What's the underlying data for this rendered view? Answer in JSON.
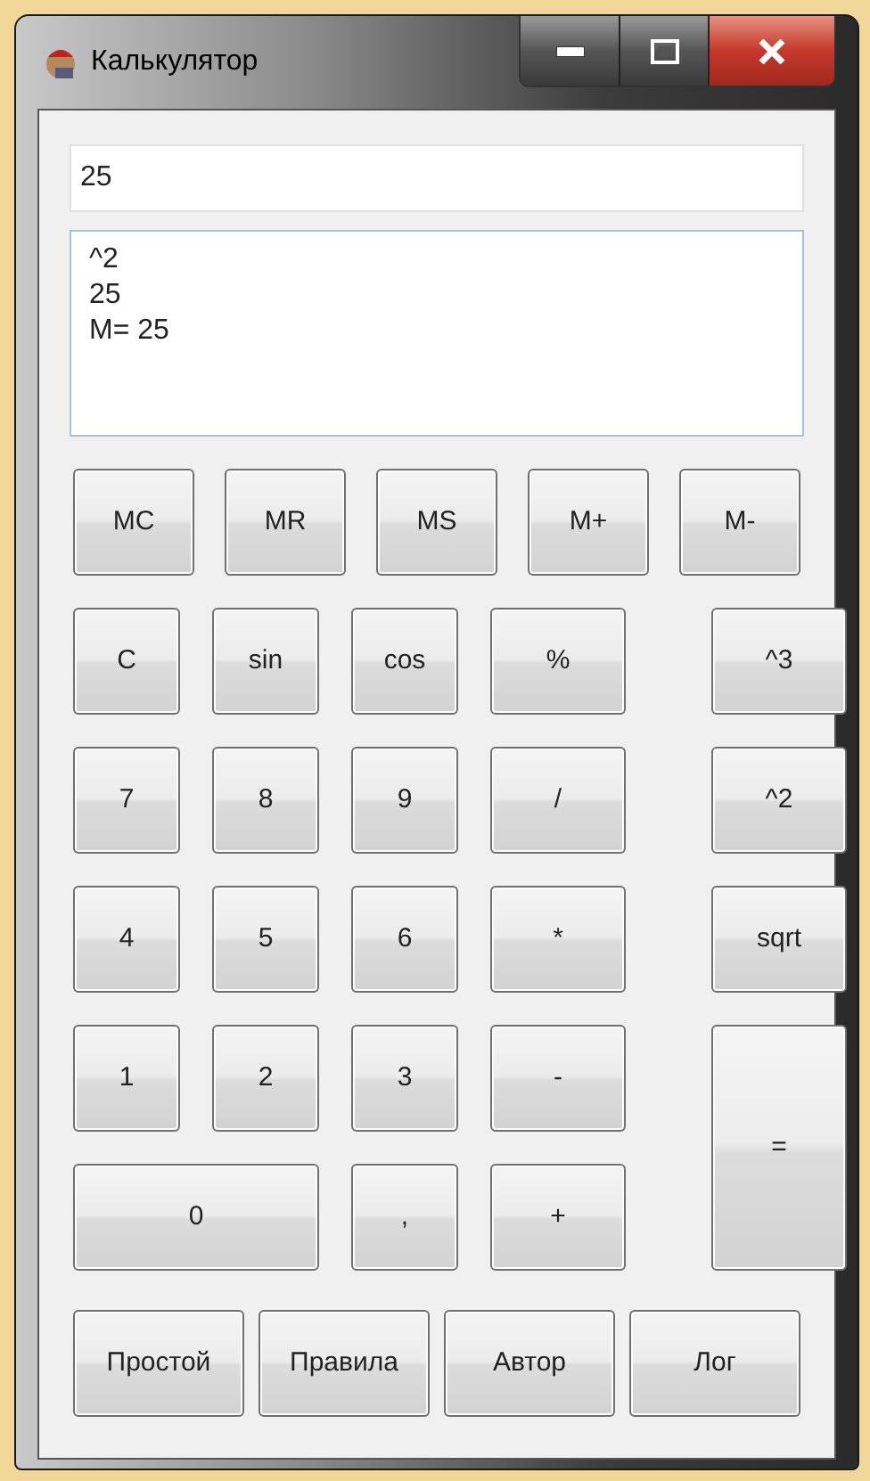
{
  "window": {
    "title": "Калькулятор"
  },
  "display": {
    "value": "25"
  },
  "log": {
    "lines": [
      "^2",
      "25",
      "M= 25"
    ]
  },
  "memory_buttons": [
    "MC",
    "MR",
    "MS",
    "M+",
    "M-"
  ],
  "keypad": [
    {
      "label": "C",
      "kind": "normal"
    },
    {
      "label": "sin",
      "kind": "normal"
    },
    {
      "label": "cos",
      "kind": "normal"
    },
    {
      "label": "%",
      "kind": "normal"
    },
    {
      "label": "^3",
      "kind": "side"
    },
    {
      "label": "7",
      "kind": "normal"
    },
    {
      "label": "8",
      "kind": "normal"
    },
    {
      "label": "9",
      "kind": "normal"
    },
    {
      "label": "/",
      "kind": "normal"
    },
    {
      "label": "^2",
      "kind": "side"
    },
    {
      "label": "4",
      "kind": "normal"
    },
    {
      "label": "5",
      "kind": "normal"
    },
    {
      "label": "6",
      "kind": "normal"
    },
    {
      "label": "*",
      "kind": "normal"
    },
    {
      "label": "sqrt",
      "kind": "side"
    },
    {
      "label": "1",
      "kind": "normal"
    },
    {
      "label": "2",
      "kind": "normal"
    },
    {
      "label": "3",
      "kind": "normal"
    },
    {
      "label": "-",
      "kind": "normal"
    },
    {
      "label": "=",
      "kind": "tall"
    },
    {
      "label": "0",
      "kind": "wide"
    },
    {
      "label": ",",
      "kind": "normal"
    },
    {
      "label": "+",
      "kind": "normal"
    }
  ],
  "bottom_buttons": [
    "Простой",
    "Правила",
    "Автор",
    "Лог"
  ]
}
